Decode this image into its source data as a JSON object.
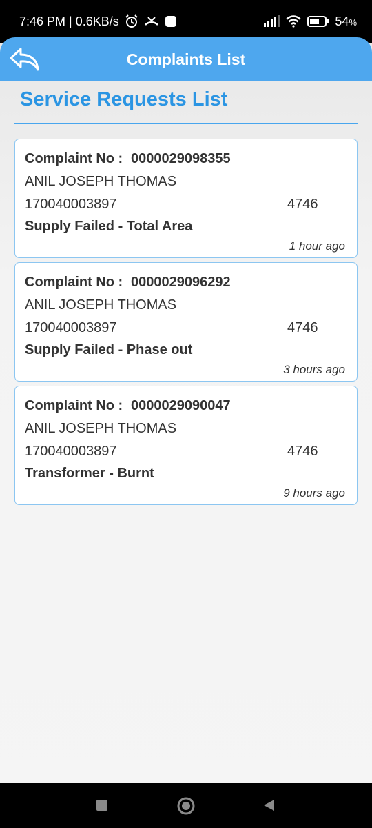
{
  "status_bar": {
    "time_speed": "7:46 PM | 0.6KB/s",
    "battery": "54",
    "battery_unit": "%"
  },
  "header": {
    "title": "Complaints List",
    "back_icon": "back-arrow-icon",
    "color": "#4ea7ee"
  },
  "section": {
    "title": "Service Requests List"
  },
  "complaints": [
    {
      "label": "Complaint No :",
      "number": "0000029098355",
      "name": "ANIL JOSEPH THOMAS",
      "consumer_no": "170040003897",
      "code": "4746",
      "category": "Supply Failed - Total Area",
      "time": "1 hour ago"
    },
    {
      "label": "Complaint No :",
      "number": "0000029096292",
      "name": "ANIL JOSEPH THOMAS",
      "consumer_no": "170040003897",
      "code": "4746",
      "category": "Supply Failed - Phase out",
      "time": "3 hours ago"
    },
    {
      "label": "Complaint No :",
      "number": "0000029090047",
      "name": "ANIL JOSEPH THOMAS",
      "consumer_no": "170040003897",
      "code": "4746",
      "category": "Transformer - Burnt",
      "time": "9 hours ago"
    }
  ],
  "nav": {
    "recents_icon": "square-icon",
    "home_icon": "circle-icon",
    "back_icon": "triangle-icon"
  }
}
